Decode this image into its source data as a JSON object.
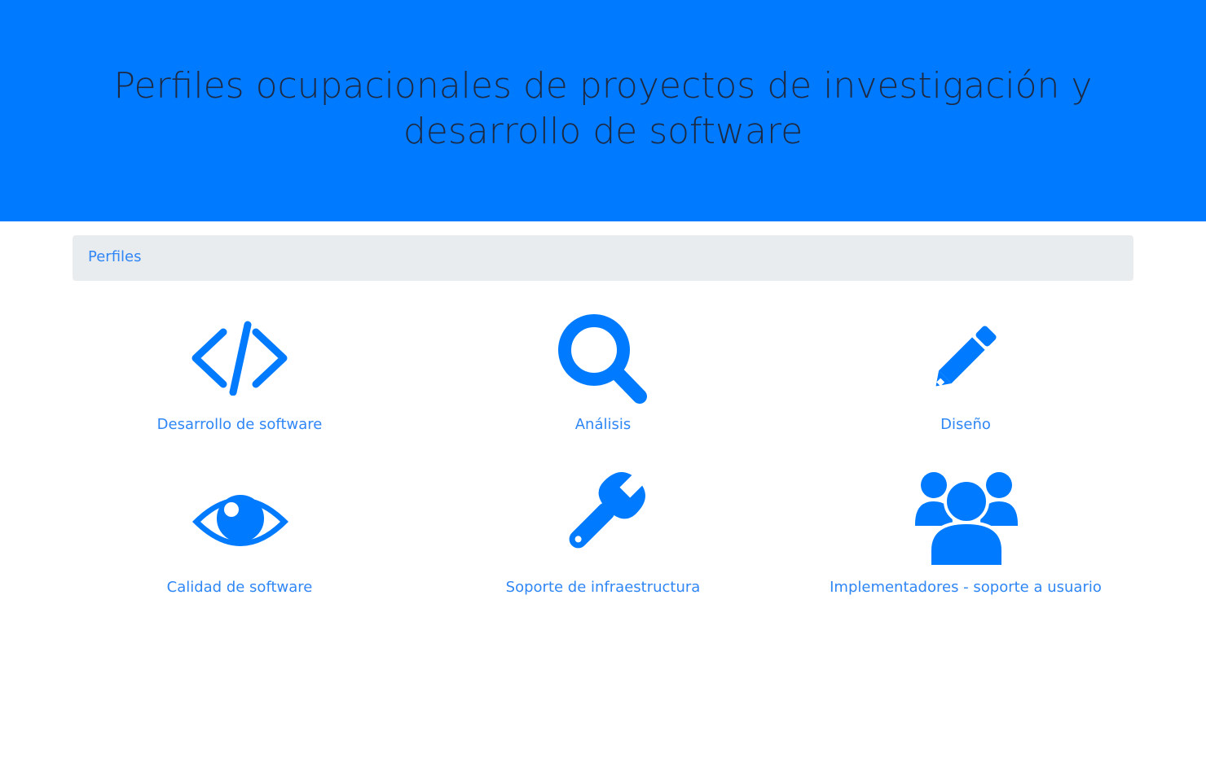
{
  "header": {
    "title": "Perfiles ocupacionales de proyectos de investigación y desarrollo de software"
  },
  "breadcrumb": {
    "items": [
      "Perfiles"
    ]
  },
  "colors": {
    "hero_background": "#007bff",
    "title_text": "#1d2a44",
    "icon": "#007bff",
    "link": "#2f86f5",
    "breadcrumb_background": "#e9ecef"
  },
  "profiles": [
    {
      "label": "Desarrollo de software",
      "icon": "code-icon"
    },
    {
      "label": "Análisis",
      "icon": "search-icon"
    },
    {
      "label": "Diseño",
      "icon": "pencil-icon"
    },
    {
      "label": "Calidad de software",
      "icon": "eye-icon"
    },
    {
      "label": "Soporte de infraestructura",
      "icon": "wrench-icon"
    },
    {
      "label": "Implementadores - soporte a usuario",
      "icon": "users-icon"
    }
  ]
}
